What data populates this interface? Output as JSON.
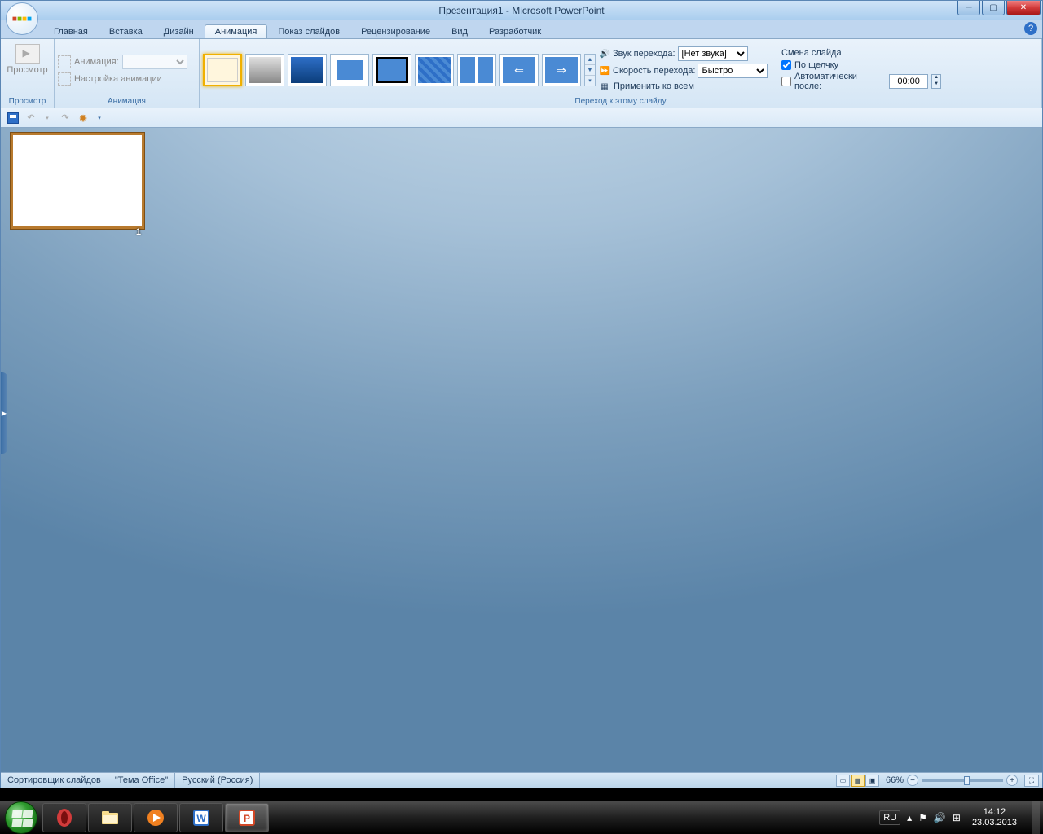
{
  "title": "Презентация1 - Microsoft PowerPoint",
  "tabs": [
    "Главная",
    "Вставка",
    "Дизайн",
    "Анимация",
    "Показ слайдов",
    "Рецензирование",
    "Вид",
    "Разработчик"
  ],
  "active_tab_index": 3,
  "ribbon": {
    "preview": {
      "button": "Просмотр",
      "group": "Просмотр"
    },
    "animation": {
      "label": "Анимация:",
      "dropdown_value": "",
      "custom": "Настройка анимации",
      "group": "Анимация"
    },
    "transition": {
      "group": "Переход к этому слайду",
      "sound_label": "Звук перехода:",
      "sound_value": "[Нет звука]",
      "speed_label": "Скорость перехода:",
      "speed_value": "Быстро",
      "apply_all": "Применить ко всем"
    },
    "advance": {
      "header": "Смена слайда",
      "on_click": "По щелчку",
      "on_click_checked": true,
      "auto_after": "Автоматически после:",
      "auto_after_checked": false,
      "time": "00:00"
    }
  },
  "slide_number": "1",
  "statusbar": {
    "mode": "Сортировщик слайдов",
    "theme": "\"Тема Office\"",
    "language": "Русский (Россия)",
    "zoom": "66%"
  },
  "taskbar": {
    "lang": "RU",
    "time": "14:12",
    "date": "23.03.2013"
  }
}
